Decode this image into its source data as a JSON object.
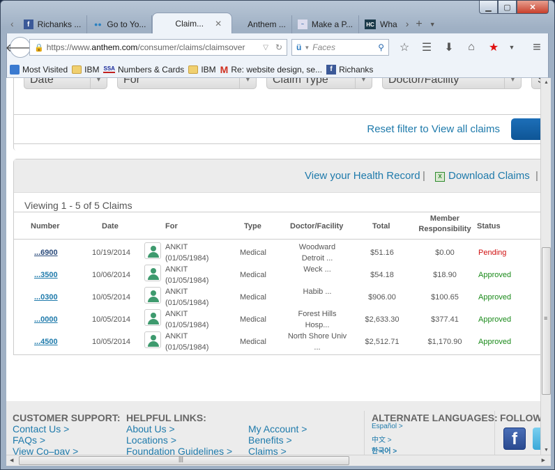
{
  "browser": {
    "tabs": [
      {
        "label": "Richanks ...",
        "icon": "facebook-icon"
      },
      {
        "label": "Go to Yo...",
        "icon": "go-icon"
      },
      {
        "label": "Claim...",
        "icon": "",
        "active": true
      },
      {
        "label": "Anthem ...",
        "icon": ""
      },
      {
        "label": "Make a P...",
        "icon": "make-payment-icon"
      },
      {
        "label": "Wha",
        "icon": "hc-icon"
      }
    ],
    "url_prefix": "https://www.",
    "url_domain": "anthem.com",
    "url_path": "/consumer/claims/claimsover",
    "search_placeholder": "Faces",
    "bookmarks": [
      {
        "label": "Most Visited",
        "icon": "most-visited-icon"
      },
      {
        "label": "IBM",
        "icon": "folder-icon"
      },
      {
        "label": "Numbers & Cards",
        "icon": "ssa-icon"
      },
      {
        "label": "IBM",
        "icon": "folder-icon"
      },
      {
        "label": "Re: website design, se...",
        "icon": "gmail-icon"
      },
      {
        "label": "Richanks",
        "icon": "facebook-icon"
      }
    ],
    "hc_label": "HC",
    "ssa_label": "SSA"
  },
  "filters": {
    "date": "Date",
    "for": "For",
    "claim_type": "Claim Type",
    "doctor": "Doctor/Facility",
    "status": "S",
    "reset_link": "Reset filter to View all claims"
  },
  "claims": {
    "health_record_link": "View your Health Record",
    "download_link": "Download Claims",
    "viewing_text": "Viewing 1 - 5 of 5 Claims",
    "columns": [
      "Number",
      "Date",
      "For",
      "Type",
      "Doctor/Facility",
      "Total",
      "Member",
      "Responsibility",
      "Status"
    ],
    "rows": [
      {
        "number": "...6900",
        "date": "10/19/2014",
        "name": "ANKIT",
        "dob": "(01/05/1984)",
        "type": "Medical",
        "doctor1": "Woodward",
        "doctor2": "Detroit ...",
        "total": "$51.16",
        "member": "$0.00",
        "status": "Pending"
      },
      {
        "number": "...3500",
        "date": "10/06/2014",
        "name": "ANKIT",
        "dob": "(01/05/1984)",
        "type": "Medical",
        "doctor1": "Weck ...",
        "doctor2": "",
        "total": "$54.18",
        "member": "$18.90",
        "status": "Approved"
      },
      {
        "number": "...0300",
        "date": "10/05/2014",
        "name": "ANKIT",
        "dob": "(01/05/1984)",
        "type": "Medical",
        "doctor1": "Habib ...",
        "doctor2": "",
        "total": "$906.00",
        "member": "$100.65",
        "status": "Approved"
      },
      {
        "number": "...0000",
        "date": "10/05/2014",
        "name": "ANKIT",
        "dob": "(01/05/1984)",
        "type": "Medical",
        "doctor1": "Forest Hills",
        "doctor2": "Hosp...",
        "total": "$2,633.30",
        "member": "$377.41",
        "status": "Approved"
      },
      {
        "number": "...4500",
        "date": "10/05/2014",
        "name": "ANKIT",
        "dob": "(01/05/1984)",
        "type": "Medical",
        "doctor1": "North Shore Univ",
        "doctor2": "...",
        "total": "$2,512.71",
        "member": "$1,170.90",
        "status": "Approved"
      }
    ]
  },
  "footer": {
    "support_heading": "CUSTOMER SUPPORT:",
    "support_links": [
      "Contact Us >",
      "FAQs >",
      "View Co–pay >"
    ],
    "helpful_heading": "HELPFUL LINKS:",
    "helpful_links_1": [
      "About Us >",
      "Locations >",
      "Foundation Guidelines >"
    ],
    "helpful_links_2": [
      "My Account >",
      "Benefits >",
      "Claims >"
    ],
    "languages_heading": "ALTERNATE LANGUAGES:",
    "languages": [
      "Español >",
      "中文 >",
      "한국어 >"
    ],
    "follow_heading": "FOLLOW",
    "facebook_glyph": "f"
  },
  "colors": {
    "link": "#1e7aab",
    "pending": "#d01010",
    "approved": "#1a8a1a"
  }
}
